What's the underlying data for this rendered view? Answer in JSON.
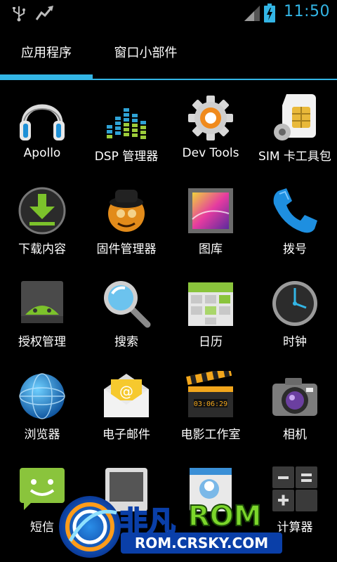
{
  "status_bar": {
    "time": "11:50",
    "icons": [
      "usb-icon",
      "signal-activity-icon",
      "cell-signal-icon",
      "battery-charging-icon"
    ],
    "accent": "#33b5e5"
  },
  "tabs": [
    {
      "label": "应用程序",
      "selected": true
    },
    {
      "label": "窗口小部件",
      "selected": false
    }
  ],
  "apps": [
    {
      "label": "Apollo",
      "icon": "headphones-icon"
    },
    {
      "label": "DSP 管理器",
      "icon": "equalizer-icon"
    },
    {
      "label": "Dev Tools",
      "icon": "gear-icon"
    },
    {
      "label": "SIM 卡工具包",
      "icon": "sim-card-icon"
    },
    {
      "label": "下载内容",
      "icon": "download-icon"
    },
    {
      "label": "固件管理器",
      "icon": "rom-manager-icon"
    },
    {
      "label": "图库",
      "icon": "gallery-icon"
    },
    {
      "label": "拨号",
      "icon": "phone-icon"
    },
    {
      "label": "授权管理",
      "icon": "superuser-icon"
    },
    {
      "label": "搜索",
      "icon": "magnifier-icon"
    },
    {
      "label": "日历",
      "icon": "calendar-icon"
    },
    {
      "label": "时钟",
      "icon": "clock-icon"
    },
    {
      "label": "浏览器",
      "icon": "globe-icon"
    },
    {
      "label": "电子邮件",
      "icon": "email-icon"
    },
    {
      "label": "电影工作室",
      "icon": "clapperboard-icon"
    },
    {
      "label": "相机",
      "icon": "camera-icon"
    },
    {
      "label": "短信",
      "icon": "sms-icon"
    },
    {
      "label": "",
      "icon": "device-icon"
    },
    {
      "label": "",
      "icon": "contacts-icon"
    },
    {
      "label": "计算器",
      "icon": "calculator-icon"
    }
  ],
  "watermark": {
    "brand_cn": "非凡",
    "brand_en": "ROM",
    "url": "ROM.CRSKY.COM"
  }
}
